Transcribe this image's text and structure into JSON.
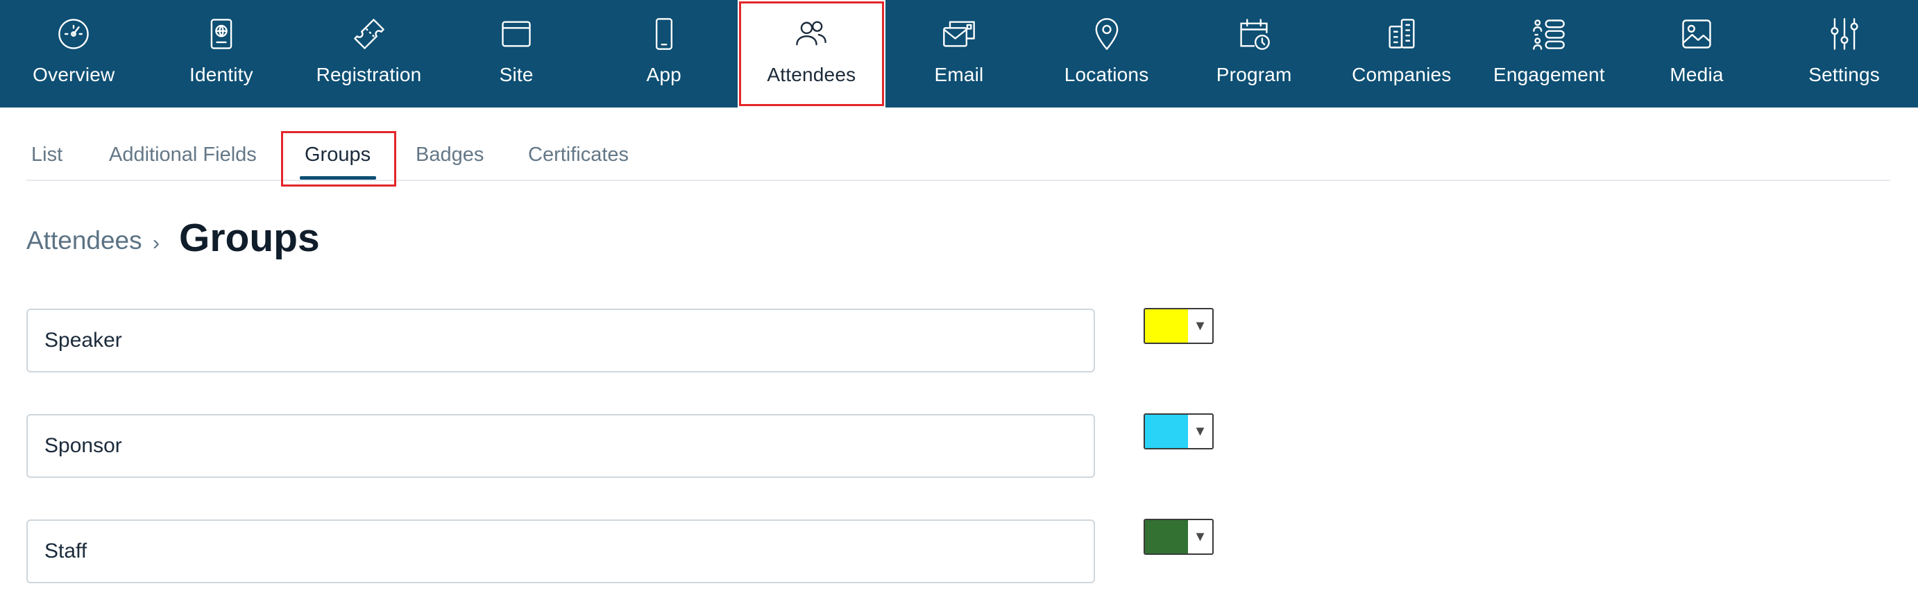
{
  "topnav": {
    "items": [
      {
        "label": "Overview",
        "icon": "gauge-icon"
      },
      {
        "label": "Identity",
        "icon": "passport-icon"
      },
      {
        "label": "Registration",
        "icon": "ticket-icon"
      },
      {
        "label": "Site",
        "icon": "browser-window-icon"
      },
      {
        "label": "App",
        "icon": "mobile-phone-icon"
      },
      {
        "label": "Attendees",
        "icon": "users-icon",
        "active": true
      },
      {
        "label": "Email",
        "icon": "email-icon"
      },
      {
        "label": "Locations",
        "icon": "map-pin-icon"
      },
      {
        "label": "Program",
        "icon": "calendar-clock-icon"
      },
      {
        "label": "Companies",
        "icon": "building-icon"
      },
      {
        "label": "Engagement",
        "icon": "engagement-icon"
      },
      {
        "label": "Media",
        "icon": "image-icon"
      },
      {
        "label": "Settings",
        "icon": "sliders-icon"
      }
    ],
    "colors": {
      "background": "#0e4f73",
      "highlight": "#e3262b"
    }
  },
  "subtabs": {
    "items": [
      "List",
      "Additional Fields",
      "Groups",
      "Badges",
      "Certificates"
    ],
    "active": "Groups"
  },
  "breadcrumb": {
    "parent": "Attendees",
    "separator": "›",
    "title": "Groups"
  },
  "groups": [
    {
      "name": "Speaker",
      "color": "#ffff00"
    },
    {
      "name": "Sponsor",
      "color": "#29d3f8"
    },
    {
      "name": "Staff",
      "color": "#327132"
    }
  ]
}
